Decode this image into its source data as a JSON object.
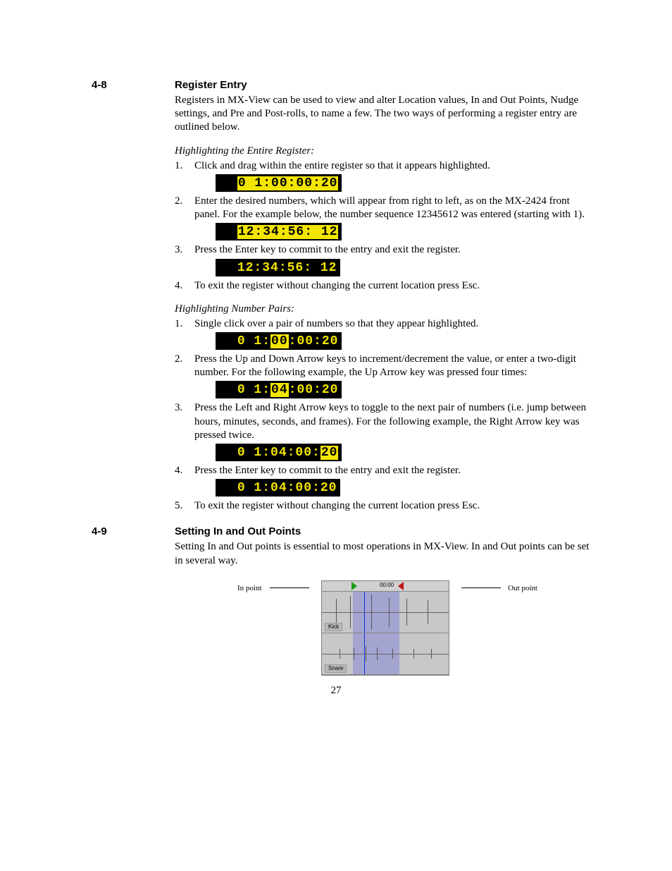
{
  "page_number": "27",
  "section48": {
    "num": "4-8",
    "title": "Register Entry",
    "intro": "Registers in MX-View can be used to view and alter Location values, In and Out Points, Nudge settings, and Pre and Post-rolls, to name a few. The two ways of performing a register entry are outlined below.",
    "blockA": {
      "heading": "Highlighting the Entire Register:",
      "steps": {
        "s1": {
          "n": "1.",
          "t": "Click and drag within the entire register so that it appears highlighted."
        },
        "s2": {
          "n": "2.",
          "t": "Enter the desired numbers, which will appear from right to left, as on the MX-2424 front panel. For the example below, the number sequence 12345612 was entered (starting with 1)."
        },
        "s3": {
          "n": "3.",
          "t": "Press the Enter key to commit to the entry and exit the register."
        },
        "s4": {
          "n": "4.",
          "t": "To exit the register without changing the current location press Esc."
        }
      },
      "lcd": {
        "d1": "0 1:00:00:20",
        "d2": "12:34:56: 12",
        "d3": "12:34:56: 12"
      }
    },
    "blockB": {
      "heading": "Highlighting Number Pairs:",
      "steps": {
        "s1": {
          "n": "1.",
          "t": "Single click over a pair of numbers so that they appear highlighted."
        },
        "s2": {
          "n": "2.",
          "t": "Press the Up and Down Arrow keys to increment/decrement the value, or enter a two-digit number. For the following example, the Up Arrow key was pressed four times:"
        },
        "s3": {
          "n": "3.",
          "t": "Press the Left and Right Arrow keys to toggle to the next pair of numbers (i.e. jump between hours, minutes, seconds, and frames).  For the following example, the Right Arrow key was pressed twice."
        },
        "s4": {
          "n": "4.",
          "t": "Press the Enter key to commit to the entry and exit the register."
        },
        "s5": {
          "n": "5.",
          "t": "To exit the register without changing the current location press Esc."
        }
      },
      "lcd": {
        "d1": {
          "pre": "0 1:",
          "hl": "00",
          "post": ":00:20"
        },
        "d2": {
          "pre": "0 1:",
          "hl": "04",
          "post": ":00:20"
        },
        "d3": {
          "pre": "0 1:04:00:",
          "hl": "20",
          "post": ""
        },
        "d4": "0 1:04:00:20"
      }
    }
  },
  "section49": {
    "num": "4-9",
    "title": "Setting In and Out Points",
    "intro": "Setting In and Out points is essential to most operations in MX-View.  In and Out points can be set in several way.",
    "fig": {
      "in_label": "In point",
      "out_label": "Out point",
      "ruler_tc": "00:00",
      "track1": "Kick",
      "track2": "Snare"
    }
  }
}
